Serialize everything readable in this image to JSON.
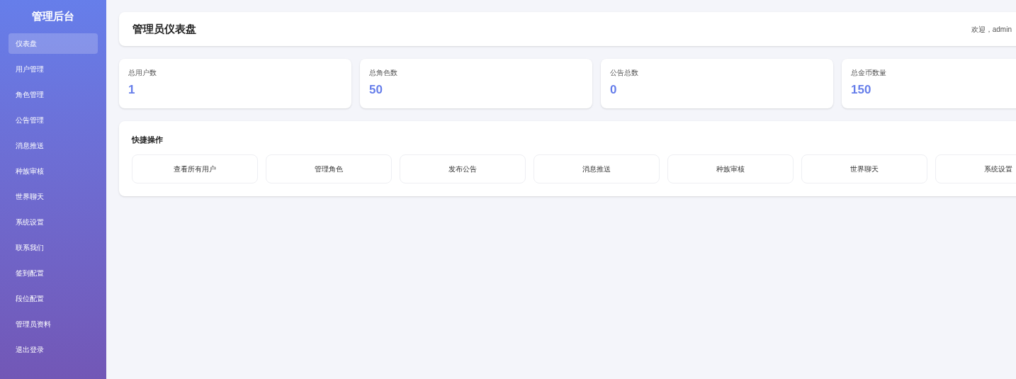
{
  "sidebar": {
    "title": "管理后台",
    "items": [
      {
        "label": "仪表盘",
        "selected": true
      },
      {
        "label": "用户管理",
        "selected": false
      },
      {
        "label": "角色管理",
        "selected": false
      },
      {
        "label": "公告管理",
        "selected": false
      },
      {
        "label": "消息推送",
        "selected": false
      },
      {
        "label": "种族审核",
        "selected": false
      },
      {
        "label": "世界聊天",
        "selected": false
      },
      {
        "label": "系统设置",
        "selected": false
      },
      {
        "label": "联系我们",
        "selected": false
      },
      {
        "label": "签到配置",
        "selected": false
      },
      {
        "label": "段位配置",
        "selected": false
      },
      {
        "label": "管理员资料",
        "selected": false
      },
      {
        "label": "退出登录",
        "selected": false
      }
    ]
  },
  "header": {
    "title": "管理员仪表盘",
    "welcome": "欢迎，admin"
  },
  "stats": [
    {
      "label": "总用户数",
      "value": "1"
    },
    {
      "label": "总角色数",
      "value": "50"
    },
    {
      "label": "公告总数",
      "value": "0"
    },
    {
      "label": "总金币数量",
      "value": "150"
    }
  ],
  "quick_actions": {
    "title": "快捷操作",
    "buttons": [
      "查看所有用户",
      "管理角色",
      "发布公告",
      "消息推送",
      "种族审核",
      "世界聊天",
      "系统设置"
    ]
  }
}
